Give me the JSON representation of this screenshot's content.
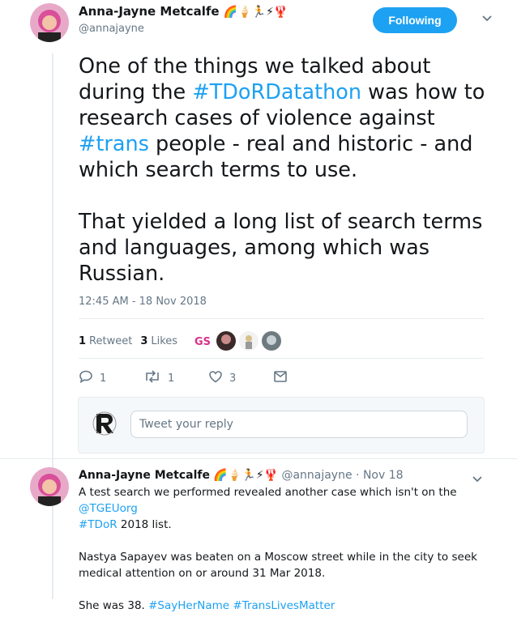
{
  "main_tweet": {
    "author_name": "Anna-Jayne Metcalfe",
    "author_emoji": "🌈🍦🏃⚡🦞",
    "handle": "@annajayne",
    "follow_label": "Following",
    "para1": {
      "t1": "One of the things we talked about during the ",
      "tag1": "#TDoRDatathon",
      "t2": " was how to research cases of violence against ",
      "tag2": "#trans",
      "t3": " people - real and historic - and which search terms to use."
    },
    "para2": "That yielded a long list of search terms and languages, among which was Russian.",
    "timestamp": "12:45 AM - 18 Nov 2018",
    "retweets_count": "1",
    "retweets_label": "Retweet",
    "likes_count": "3",
    "likes_label": "Likes",
    "actions": {
      "replies": "1",
      "retweets": "1",
      "likes": "3"
    }
  },
  "reply_box": {
    "placeholder": "Tweet your reply"
  },
  "second_tweet": {
    "author_name": "Anna-Jayne Metcalfe",
    "author_emoji": "🌈🍦🏃⚡🦞",
    "handle": "@annajayne",
    "date": "Nov 18",
    "line1_a": "A test search we performed revealed another case which isn't on the ",
    "line1_mention": "@TGEUorg",
    "line1_tag": "#TDoR",
    "line1_b": " 2018 list.",
    "para2": "Nastya Sapayev was beaten on a Moscow street while in the city to seek medical attention on or around 31 Mar 2018.",
    "para3_a": "She was 38. ",
    "para3_tag1": "#SayHerName",
    "para3_tag2": "#TransLivesMatter"
  },
  "colors": {
    "accent": "#1da1f2",
    "muted": "#657786",
    "text": "#14171a",
    "border": "#e6ecf0"
  },
  "icons": [
    "reply-icon",
    "retweet-icon",
    "heart-icon",
    "message-icon",
    "chevron-down-icon"
  ]
}
